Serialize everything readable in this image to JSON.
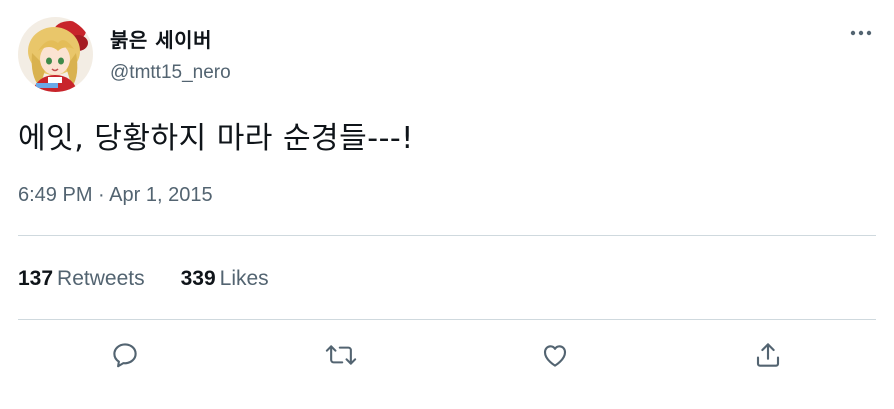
{
  "user": {
    "display_name": "붉은 세이버",
    "handle": "@tmtt15_nero"
  },
  "tweet": {
    "text": "에잇, 당황하지 마라 순경들---!",
    "timestamp": "6:49 PM · Apr 1, 2015"
  },
  "stats": {
    "retweets_count": "137",
    "retweets_label": "Retweets",
    "likes_count": "339",
    "likes_label": "Likes"
  },
  "icons": {
    "more": "more-dots-icon",
    "reply": "reply-icon",
    "retweet": "retweet-icon",
    "like": "heart-icon",
    "share": "share-icon"
  },
  "colors": {
    "text_primary": "#0f1419",
    "text_secondary": "#536471",
    "divider": "#cfd9de"
  }
}
